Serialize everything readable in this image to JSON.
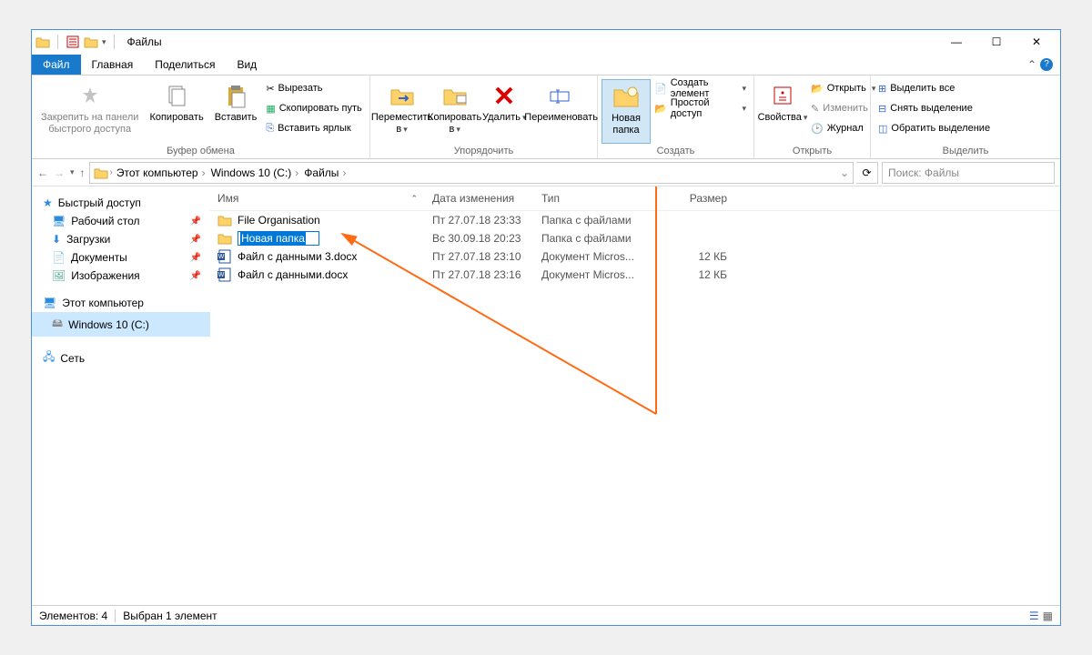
{
  "titlebar": {
    "title": "Файлы"
  },
  "window_controls": {
    "min": "—",
    "max": "☐",
    "close": "✕"
  },
  "tabs": {
    "file": "Файл",
    "home": "Главная",
    "share": "Поделиться",
    "view": "Вид"
  },
  "ribbon": {
    "clipboard": {
      "label": "Буфер обмена",
      "pin": "Закрепить на панели\nбыстрого доступа",
      "copy": "Копировать",
      "paste": "Вставить",
      "cut": "Вырезать",
      "copy_path": "Скопировать путь",
      "paste_shortcut": "Вставить ярлык"
    },
    "organize": {
      "label": "Упорядочить",
      "move_to": "Переместить\nв",
      "copy_to": "Копировать\nв",
      "delete": "Удалить",
      "rename": "Переименовать"
    },
    "new": {
      "label": "Создать",
      "new_folder": "Новая\nпапка",
      "new_item": "Создать элемент",
      "easy_access": "Простой доступ"
    },
    "open": {
      "label": "Открыть",
      "properties": "Свойства",
      "open": "Открыть",
      "edit": "Изменить",
      "history": "Журнал"
    },
    "select": {
      "label": "Выделить",
      "select_all": "Выделить все",
      "select_none": "Снять выделение",
      "invert": "Обратить выделение"
    }
  },
  "breadcrumb": {
    "this_pc": "Этот компьютер",
    "drive": "Windows 10 (C:)",
    "folder": "Файлы"
  },
  "search": {
    "placeholder": "Поиск: Файлы"
  },
  "sidebar": {
    "quick_access": "Быстрый доступ",
    "desktop": "Рабочий стол",
    "downloads": "Загрузки",
    "documents": "Документы",
    "pictures": "Изображения",
    "this_pc": "Этот компьютер",
    "drive": "Windows 10 (C:)",
    "network": "Сеть"
  },
  "columns": {
    "name": "Имя",
    "date": "Дата изменения",
    "type": "Тип",
    "size": "Размер"
  },
  "files": [
    {
      "name": "File Organisation",
      "date": "Пт 27.07.18 23:33",
      "type": "Папка с файлами",
      "size": ""
    },
    {
      "name": "Новая папка",
      "date": "Вс 30.09.18 20:23",
      "type": "Папка с файлами",
      "size": "",
      "renaming": true
    },
    {
      "name": "Файл с данными 3.docx",
      "date": "Пт 27.07.18 23:10",
      "type": "Документ Micros...",
      "size": "12 КБ"
    },
    {
      "name": "Файл с данными.docx",
      "date": "Пт 27.07.18 23:16",
      "type": "Документ Micros...",
      "size": "12 КБ"
    }
  ],
  "statusbar": {
    "items": "Элементов: 4",
    "selected": "Выбран 1 элемент"
  }
}
